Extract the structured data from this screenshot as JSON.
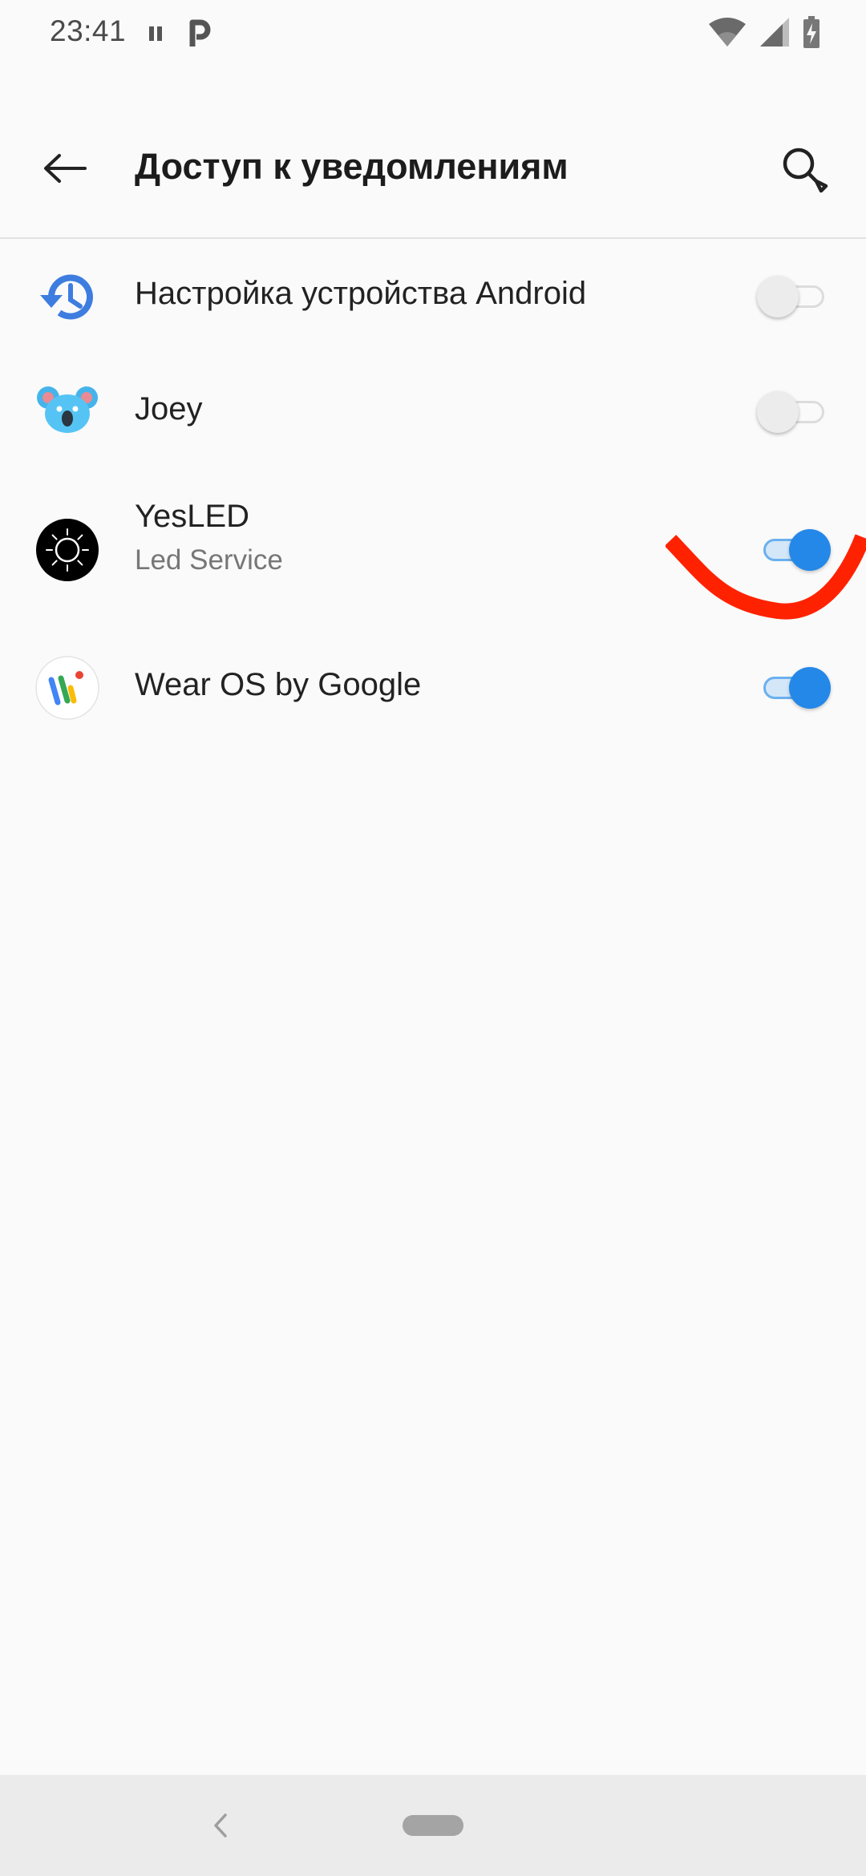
{
  "status_bar": {
    "time": "23:41",
    "left_icons": [
      "pause-icon",
      "parking-icon"
    ],
    "right_icons": [
      "wifi-icon",
      "cell-signal-icon",
      "battery-charging-icon"
    ]
  },
  "app_bar": {
    "title": "Доступ к уведомлениям",
    "back_icon": "arrow-back-icon",
    "search_icon": "search-icon"
  },
  "apps": [
    {
      "name": "Настройка устройства Android",
      "subtitle": "",
      "icon": "restore-history-icon",
      "enabled": false
    },
    {
      "name": "Joey",
      "subtitle": "",
      "icon": "koala-icon",
      "enabled": false
    },
    {
      "name": "YesLED",
      "subtitle": "Led Service",
      "icon": "sun-icon",
      "enabled": true
    },
    {
      "name": "Wear OS by Google",
      "subtitle": "",
      "icon": "wear-os-icon",
      "enabled": true
    }
  ],
  "colors": {
    "accent": "#2388e8",
    "annotation": "#ff2200",
    "background": "#fafafa"
  },
  "nav_bar": {
    "back_icon": "nav-back-chevron-icon",
    "home_icon": "nav-home-pill-icon"
  }
}
